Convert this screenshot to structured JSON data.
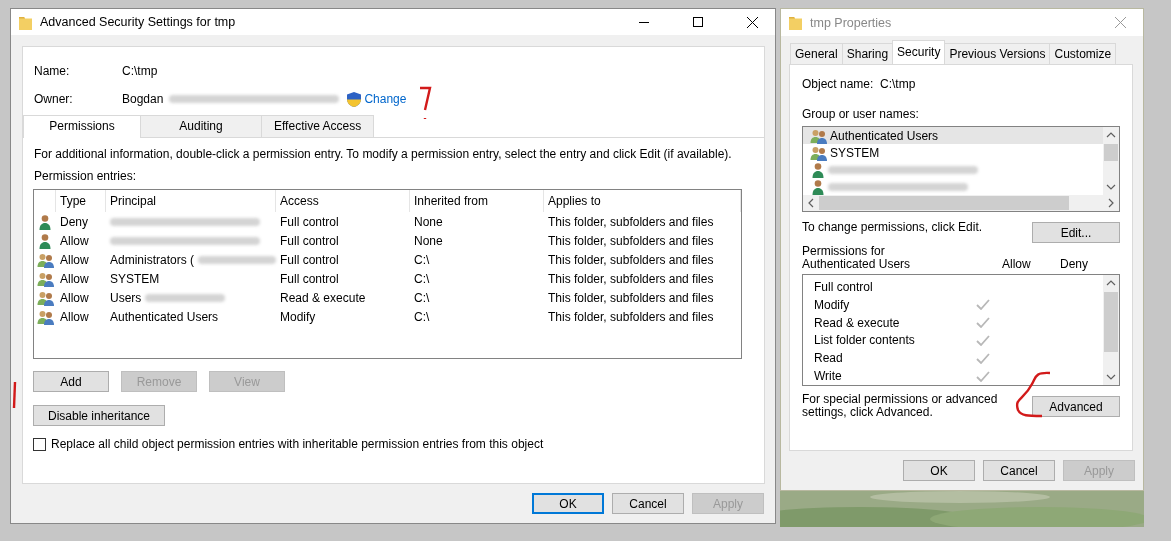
{
  "advanced_window": {
    "title": "Advanced Security Settings for tmp",
    "name_label": "Name:",
    "name_value": "C:\\tmp",
    "owner_label": "Owner:",
    "owner_value": "Bogdan",
    "change_link": "Change",
    "tabs": [
      {
        "label": "Permissions",
        "selected": true
      },
      {
        "label": "Auditing",
        "selected": false
      },
      {
        "label": "Effective Access",
        "selected": false
      }
    ],
    "info_text": "For additional information, double-click a permission entry. To modify a permission entry, select the entry and click Edit (if available).",
    "entries_label": "Permission entries:",
    "columns": [
      "Type",
      "Principal",
      "Access",
      "Inherited from",
      "Applies to"
    ],
    "rows": [
      {
        "kind": "user",
        "type": "Deny",
        "redacted": true,
        "access": "Full control",
        "inherited_from": "None",
        "applies_to": "This folder, subfolders and files"
      },
      {
        "kind": "user",
        "type": "Allow",
        "redacted": true,
        "access": "Full control",
        "inherited_from": "None",
        "applies_to": "This folder, subfolders and files"
      },
      {
        "kind": "group",
        "type": "Allow",
        "principal": "Administrators (",
        "redacted": true,
        "access": "Full control",
        "inherited_from": "C:\\",
        "applies_to": "This folder, subfolders and files"
      },
      {
        "kind": "group",
        "type": "Allow",
        "principal": "SYSTEM",
        "redacted": false,
        "access": "Full control",
        "inherited_from": "C:\\",
        "applies_to": "This folder, subfolders and files"
      },
      {
        "kind": "group",
        "type": "Allow",
        "principal": "Users",
        "redacted": true,
        "access": "Read & execute",
        "inherited_from": "C:\\",
        "applies_to": "This folder, subfolders and files"
      },
      {
        "kind": "group",
        "type": "Allow",
        "principal": "Authenticated Users",
        "redacted": false,
        "access": "Modify",
        "inherited_from": "C:\\",
        "applies_to": "This folder, subfolders and files"
      }
    ],
    "entry_buttons": [
      {
        "label": "Add",
        "disabled": false
      },
      {
        "label": "Remove",
        "disabled": true
      },
      {
        "label": "View",
        "disabled": true
      }
    ],
    "inheritance_button": "Disable inheritance",
    "replace_checkbox": {
      "label": "Replace all child object permission entries with inheritable permission entries from this object",
      "checked": false
    },
    "footer_buttons": [
      {
        "label": "OK",
        "disabled": false,
        "default": true
      },
      {
        "label": "Cancel",
        "disabled": false,
        "default": false
      },
      {
        "label": "Apply",
        "disabled": true,
        "default": false
      }
    ]
  },
  "properties_window": {
    "title": "tmp Properties",
    "tabs": [
      {
        "label": "General",
        "selected": false
      },
      {
        "label": "Sharing",
        "selected": false
      },
      {
        "label": "Security",
        "selected": true
      },
      {
        "label": "Previous Versions",
        "selected": false
      },
      {
        "label": "Customize",
        "selected": false
      }
    ],
    "object_name_label": "Object name:",
    "object_name_value": "C:\\tmp",
    "group_label": "Group or user names:",
    "groups": [
      {
        "kind": "group",
        "name": "Authenticated Users",
        "selected": true
      },
      {
        "kind": "group",
        "name": "SYSTEM",
        "selected": false
      },
      {
        "kind": "user",
        "redacted": true,
        "selected": false
      },
      {
        "kind": "user",
        "redacted": true,
        "selected": false
      }
    ],
    "edit_text": "To change permissions, click Edit.",
    "edit_button": "Edit...",
    "permissions_label": "Permissions for Authenticated Users",
    "allow_header": "Allow",
    "deny_header": "Deny",
    "permissions": [
      {
        "name": "Full control",
        "allow": false,
        "deny": false
      },
      {
        "name": "Modify",
        "allow": true,
        "deny": false
      },
      {
        "name": "Read & execute",
        "allow": true,
        "deny": false
      },
      {
        "name": "List folder contents",
        "allow": true,
        "deny": false
      },
      {
        "name": "Read",
        "allow": true,
        "deny": false
      },
      {
        "name": "Write",
        "allow": true,
        "deny": false
      }
    ],
    "advanced_text": "For special permissions or advanced settings, click Advanced.",
    "advanced_button": "Advanced",
    "footer_buttons": [
      {
        "label": "OK",
        "disabled": false,
        "default": false
      },
      {
        "label": "Cancel",
        "disabled": false,
        "default": false
      },
      {
        "label": "Apply",
        "disabled": true,
        "default": false
      }
    ]
  }
}
